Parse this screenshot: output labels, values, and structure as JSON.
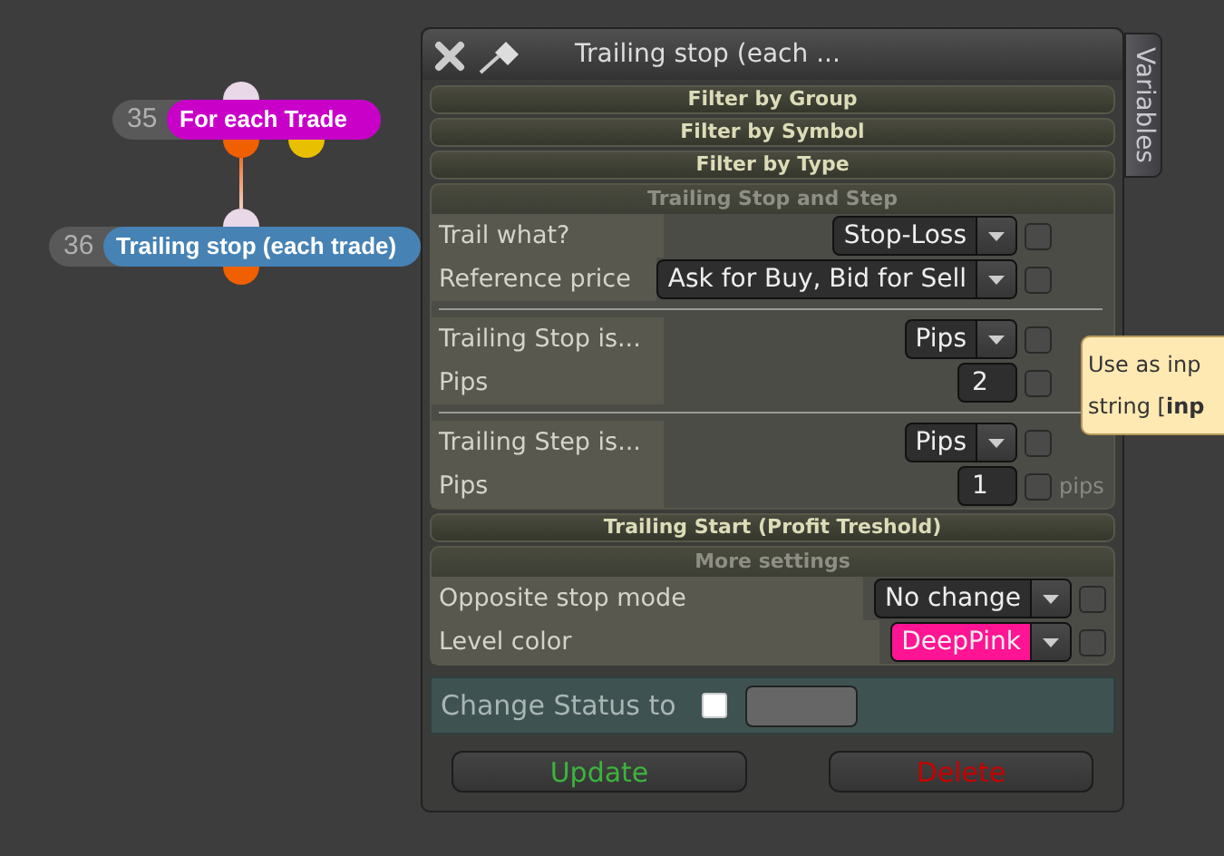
{
  "nodes": [
    {
      "number": "35",
      "label": "For each Trade",
      "color": "#c800c8"
    },
    {
      "number": "36",
      "label": "Trailing stop (each trade)",
      "color": "#4682b4"
    }
  ],
  "dialog": {
    "title": "Trailing stop (each ...",
    "side_tab": "Variables",
    "sections": [
      {
        "kind": "bar",
        "title": "Filter by Group"
      },
      {
        "kind": "bar",
        "title": "Filter by Symbol"
      },
      {
        "kind": "bar",
        "title": "Filter by Type"
      },
      {
        "kind": "group",
        "title": "Trailing Stop and Step",
        "blocks": [
          [
            {
              "label": "Trail what?",
              "kind": "select",
              "value": "Stop-Loss",
              "checked": false
            },
            {
              "label": "Reference price",
              "kind": "select",
              "value": "Ask for Buy, Bid for Sell",
              "checked": false
            }
          ],
          [
            {
              "label": "Trailing Stop is...",
              "kind": "select",
              "value": "Pips",
              "checked": false
            },
            {
              "label": "Pips",
              "kind": "number",
              "value": "2",
              "checked": false
            }
          ],
          [
            {
              "label": "Trailing Step is...",
              "kind": "select",
              "value": "Pips",
              "checked": false
            },
            {
              "label": "Pips",
              "kind": "number",
              "value": "1",
              "checked": false,
              "unit": "pips"
            }
          ]
        ]
      },
      {
        "kind": "bar",
        "title": "Trailing Start (Profit Treshold)"
      },
      {
        "kind": "group",
        "title": "More settings",
        "blocks": [
          [
            {
              "label": "Opposite stop mode",
              "kind": "select",
              "value": "No change",
              "checked": false
            },
            {
              "label": "Level color",
              "kind": "select",
              "value": "DeepPink",
              "checked": false,
              "color": "#ff1493"
            }
          ]
        ]
      }
    ],
    "status": {
      "label": "Change Status to",
      "checked": false
    },
    "buttons": [
      {
        "label": "Update",
        "kind": "update"
      },
      {
        "label": "Delete",
        "kind": "delete"
      }
    ]
  },
  "tooltip": {
    "lines": [
      "Use as inp",
      "string [**inp**"
    ]
  }
}
